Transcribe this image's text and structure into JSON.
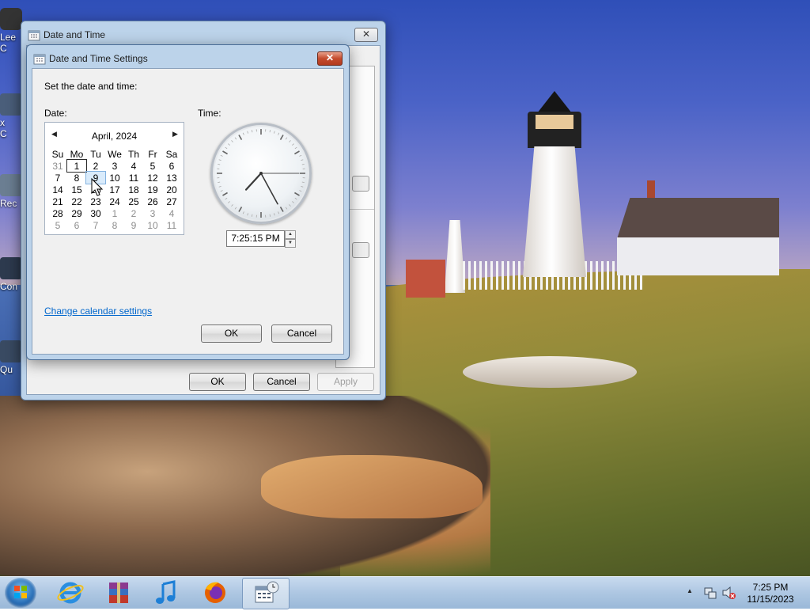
{
  "desktop": {
    "icons": [
      {
        "label": "Lee\nC"
      },
      {
        "label": "x\nC"
      },
      {
        "label": "Rec"
      },
      {
        "label": "Con"
      },
      {
        "label": "Qu"
      }
    ]
  },
  "outer_dialog": {
    "title": "Date and Time",
    "close_glyph": "✕",
    "ok_label": "OK",
    "cancel_label": "Cancel",
    "apply_label": "Apply"
  },
  "settings_dialog": {
    "title": "Date and Time Settings",
    "close_glyph": "✕",
    "instruction": "Set the date and time:",
    "date_label": "Date:",
    "time_label": "Time:",
    "calendar": {
      "month_label": "April, 2024",
      "prev_glyph": "◀",
      "next_glyph": "▶",
      "weekdays": [
        "Su",
        "Mo",
        "Tu",
        "We",
        "Th",
        "Fr",
        "Sa"
      ],
      "weeks": [
        [
          "31",
          "1",
          "2",
          "3",
          "4",
          "5",
          "6"
        ],
        [
          "7",
          "8",
          "9",
          "10",
          "11",
          "12",
          "13"
        ],
        [
          "14",
          "15",
          "16",
          "17",
          "18",
          "19",
          "20"
        ],
        [
          "21",
          "22",
          "23",
          "24",
          "25",
          "26",
          "27"
        ],
        [
          "28",
          "29",
          "30",
          "1",
          "2",
          "3",
          "4"
        ],
        [
          "5",
          "6",
          "7",
          "8",
          "9",
          "10",
          "11"
        ]
      ],
      "today_day": "1",
      "selected_day": "9"
    },
    "clock": {
      "hour": 7,
      "minute": 25,
      "second": 15
    },
    "time_value": "7:25:15 PM",
    "spin_up_glyph": "▲",
    "spin_down_glyph": "▼",
    "change_calendar_link": "Change calendar settings",
    "ok_label": "OK",
    "cancel_label": "Cancel"
  },
  "taskbar": {
    "items": [
      {
        "name": "internet-explorer-icon"
      },
      {
        "name": "winrar-icon"
      },
      {
        "name": "music-player-icon"
      },
      {
        "name": "firefox-icon"
      },
      {
        "name": "date-time-app-icon"
      }
    ],
    "tray_arrow": "▲",
    "clock_time": "7:25 PM",
    "clock_date": "11/15/2023"
  }
}
